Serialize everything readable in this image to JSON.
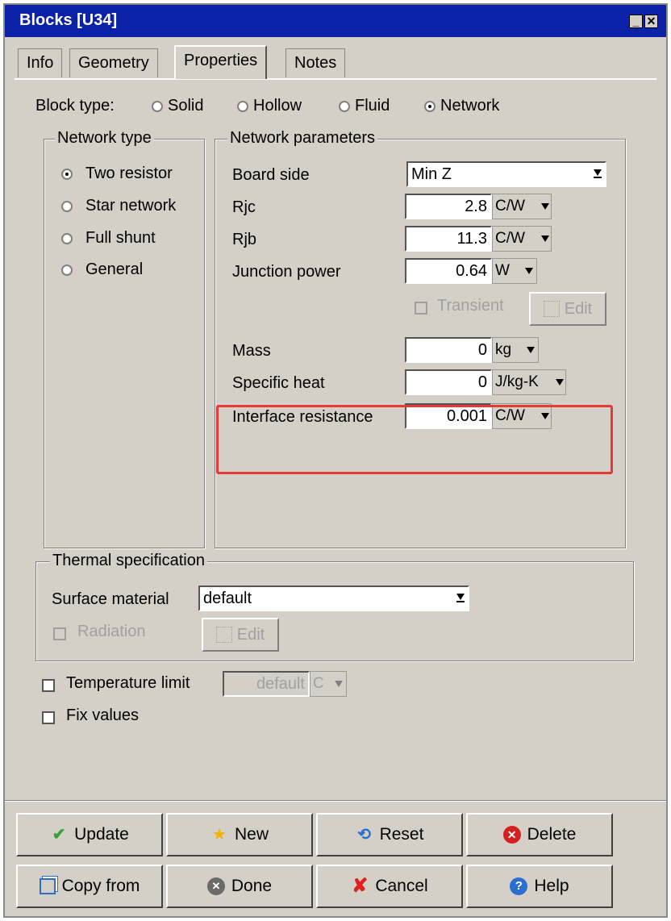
{
  "window": {
    "title": "Blocks [U34]"
  },
  "tabs": [
    {
      "label": "Info"
    },
    {
      "label": "Geometry"
    },
    {
      "label": "Properties"
    },
    {
      "label": "Notes"
    }
  ],
  "block_type": {
    "label": "Block type:",
    "options": [
      {
        "label": "Solid",
        "selected": false
      },
      {
        "label": "Hollow",
        "selected": false
      },
      {
        "label": "Fluid",
        "selected": false
      },
      {
        "label": "Network",
        "selected": true
      }
    ]
  },
  "network_type": {
    "title": "Network type",
    "options": [
      {
        "label": "Two resistor",
        "selected": true
      },
      {
        "label": "Star network",
        "selected": false
      },
      {
        "label": "Full shunt",
        "selected": false
      },
      {
        "label": "General",
        "selected": false
      }
    ]
  },
  "network_params": {
    "title": "Network parameters",
    "board_side": {
      "label": "Board side",
      "value": "Min Z"
    },
    "rjc": {
      "label": "Rjc",
      "value": "2.8",
      "unit": "C/W"
    },
    "rjb": {
      "label": "Rjb",
      "value": "11.3",
      "unit": "C/W"
    },
    "junction_power": {
      "label": "Junction power",
      "value": "0.64",
      "unit": "W"
    },
    "transient": {
      "label": "Transient",
      "checked": false,
      "edit_label": "Edit"
    },
    "mass": {
      "label": "Mass",
      "value": "0",
      "unit": "kg"
    },
    "specific_heat": {
      "label": "Specific heat",
      "value": "0",
      "unit": "J/kg-K"
    },
    "interface_resistance": {
      "label": "Interface resistance",
      "value": "0.001",
      "unit": "C/W"
    }
  },
  "thermal": {
    "title": "Thermal specification",
    "surface_material": {
      "label": "Surface material",
      "value": "default"
    },
    "radiation": {
      "label": "Radiation",
      "checked": false,
      "edit_label": "Edit"
    }
  },
  "temperature_limit": {
    "label": "Temperature limit",
    "value": "default",
    "unit": "C",
    "checked": false
  },
  "fix_values": {
    "label": "Fix values",
    "checked": false
  },
  "buttons": {
    "update": "Update",
    "new": "New",
    "reset": "Reset",
    "delete": "Delete",
    "copy_from": "Copy from",
    "done": "Done",
    "cancel": "Cancel",
    "help": "Help"
  },
  "colors": {
    "titlebar": "#0a21a8",
    "highlight": "#e53935",
    "background": "#d4d0c8"
  }
}
